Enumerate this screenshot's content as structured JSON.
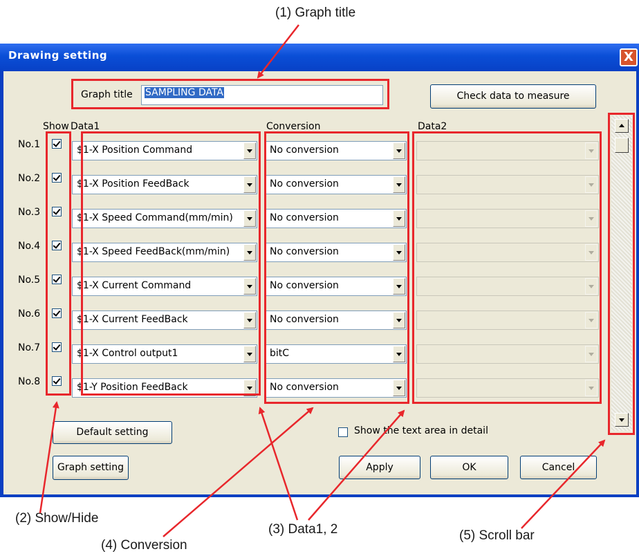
{
  "window": {
    "title": "Drawing setting",
    "close": "X"
  },
  "graph_title": {
    "label": "Graph title",
    "value": "SAMPLING DATA"
  },
  "buttons": {
    "check_data": "Check data to measure",
    "default_setting": "Default setting",
    "graph_setting": "Graph setting",
    "apply": "Apply",
    "ok": "OK",
    "cancel": "Cancel"
  },
  "headers": {
    "show": "Show",
    "data1": "Data1",
    "conversion": "Conversion",
    "data2": "Data2"
  },
  "rows": [
    {
      "no": "No.1",
      "show": true,
      "data1": "$1-X Position Command",
      "conversion": "No conversion",
      "data2": ""
    },
    {
      "no": "No.2",
      "show": true,
      "data1": "$1-X Position FeedBack",
      "conversion": "No conversion",
      "data2": ""
    },
    {
      "no": "No.3",
      "show": true,
      "data1": "$1-X Speed Command(mm/min)",
      "conversion": "No conversion",
      "data2": ""
    },
    {
      "no": "No.4",
      "show": true,
      "data1": "$1-X Speed FeedBack(mm/min)",
      "conversion": "No conversion",
      "data2": ""
    },
    {
      "no": "No.5",
      "show": true,
      "data1": "$1-X Current Command",
      "conversion": "No conversion",
      "data2": ""
    },
    {
      "no": "No.6",
      "show": true,
      "data1": "$1-X Current FeedBack",
      "conversion": "No conversion",
      "data2": ""
    },
    {
      "no": "No.7",
      "show": true,
      "data1": "$1-X Control output1",
      "conversion": "bitC",
      "data2": ""
    },
    {
      "no": "No.8",
      "show": true,
      "data1": "$1-Y Position FeedBack",
      "conversion": "No conversion",
      "data2": ""
    }
  ],
  "detail_checkbox": {
    "label": "Show the text area in detail",
    "checked": false
  },
  "callouts": {
    "graph_title": "(1) Graph title",
    "show_hide": "(2) Show/Hide",
    "data12": "(3) Data1, 2",
    "conversion": "(4) Conversion",
    "scroll_bar": "(5) Scroll bar"
  },
  "colors": {
    "highlight_box": "#e8272c",
    "titlebar": "#0a4ed6",
    "dialog_bg": "#ece9d8"
  }
}
